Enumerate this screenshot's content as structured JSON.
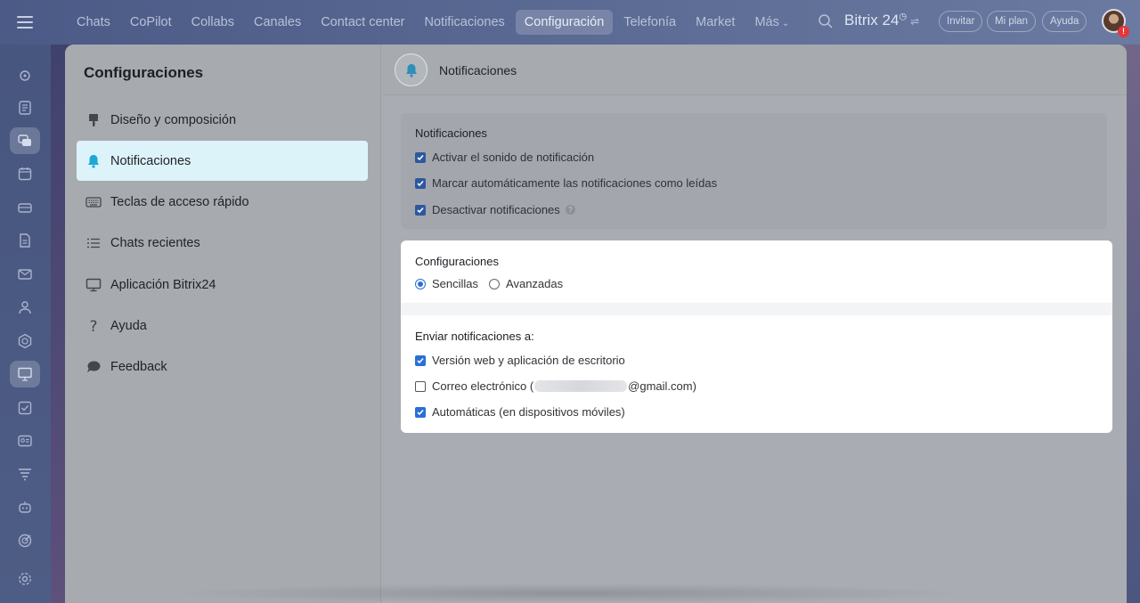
{
  "topbar": {
    "nav": [
      {
        "label": "Chats",
        "active": false
      },
      {
        "label": "CoPilot",
        "active": false
      },
      {
        "label": "Collabs",
        "active": false
      },
      {
        "label": "Canales",
        "active": false
      },
      {
        "label": "Contact center",
        "active": false
      },
      {
        "label": "Notificaciones",
        "active": false
      },
      {
        "label": "Configuración",
        "active": true
      },
      {
        "label": "Telefonía",
        "active": false
      },
      {
        "label": "Market",
        "active": false
      },
      {
        "label": "Más",
        "active": false
      }
    ],
    "brand": "Bitrix 24",
    "invite_label": "Invitar",
    "plan_label": "Mi plan",
    "help_label": "Ayuda",
    "avatar_badge": "!"
  },
  "rail": {
    "icons": [
      "copilot-icon",
      "feed-icon",
      "chat-icon",
      "calendar-icon",
      "drive-icon",
      "document-icon",
      "mail-icon",
      "contacts-icon",
      "hexagon-icon",
      "presentation-icon",
      "tasks-icon",
      "crm-icon",
      "funnel-icon",
      "robot-icon",
      "target-icon",
      "settings-icon"
    ],
    "active_index": 2
  },
  "sidebar": {
    "title": "Configuraciones",
    "items": [
      {
        "label": "Diseño y composición",
        "icon": "brush-icon",
        "active": false
      },
      {
        "label": "Notificaciones",
        "icon": "bell-icon",
        "active": true
      },
      {
        "label": "Teclas de acceso rápido",
        "icon": "keyboard-icon",
        "active": false
      },
      {
        "label": "Chats recientes",
        "icon": "list-icon",
        "active": false
      },
      {
        "label": "Aplicación Bitrix24",
        "icon": "monitor-icon",
        "active": false
      },
      {
        "label": "Ayuda",
        "icon": "question-icon",
        "active": false
      },
      {
        "label": "Feedback",
        "icon": "speech-bubble-icon",
        "active": false
      }
    ]
  },
  "content": {
    "header_title": "Notificaciones",
    "notifications_card": {
      "title": "Notificaciones",
      "options": [
        {
          "label": "Activar el sonido de notificación",
          "checked": true
        },
        {
          "label": "Marcar automáticamente las notificaciones como leídas",
          "checked": true
        },
        {
          "label": "Desactivar notificaciones",
          "checked": true,
          "help": "?"
        }
      ]
    },
    "settings_card": {
      "title": "Configuraciones",
      "modes": [
        {
          "label": "Sencillas",
          "selected": true
        },
        {
          "label": "Avanzadas",
          "selected": false
        }
      ]
    },
    "send_card": {
      "title": "Enviar notificaciones a:",
      "web_label": "Versión web y aplicación de escritorio",
      "web_checked": true,
      "email_prefix": "Correo electrónico (",
      "email_suffix": "@gmail.com)",
      "email_checked": false,
      "mobile_label": "Automáticas (en dispositivos móviles)",
      "mobile_checked": true
    }
  },
  "colors": {
    "accent": "#2a6fd6",
    "active_menu_bg": "#ddf3fa",
    "bell": "#1ea7d8",
    "badge": "#e8353a"
  }
}
